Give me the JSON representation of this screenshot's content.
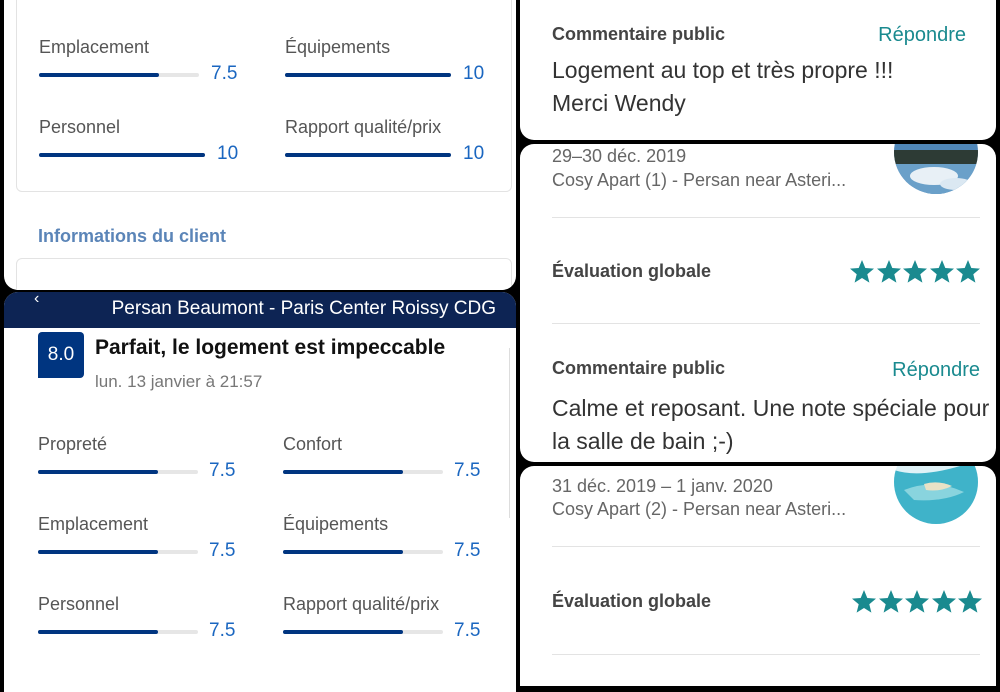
{
  "left_top": {
    "metrics": [
      {
        "label": "Emplacement",
        "value": "7.5",
        "fraction": 0.75
      },
      {
        "label": "Équipements",
        "value": "10",
        "fraction": 1.0
      },
      {
        "label": "Personnel",
        "value": "10",
        "fraction": 1.0
      },
      {
        "label": "Rapport qualité/prix",
        "value": "10",
        "fraction": 1.0
      }
    ],
    "info_title": "Informations du client"
  },
  "left_bottom": {
    "header_title": "Persan Beaumont - Paris Center Roissy CDG",
    "score": "8.0",
    "review_title": "Parfait, le logement est impeccable",
    "review_date": "lun. 13 janvier à 21:57",
    "metrics": [
      {
        "label": "Propreté",
        "value": "7.5",
        "fraction": 0.75
      },
      {
        "label": "Confort",
        "value": "7.5",
        "fraction": 0.75
      },
      {
        "label": "Emplacement",
        "value": "7.5",
        "fraction": 0.75
      },
      {
        "label": "Équipements",
        "value": "7.5",
        "fraction": 0.75
      },
      {
        "label": "Personnel",
        "value": "7.5",
        "fraction": 0.75
      },
      {
        "label": "Rapport qualité/prix",
        "value": "7.5",
        "fraction": 0.75
      }
    ]
  },
  "right_top": {
    "label": "Commentaire public",
    "reply": "Répondre",
    "comment": "Logement au top et très propre !!! Merci Wendy"
  },
  "right_mid": {
    "date": "29–30 déc. 2019",
    "listing": "Cosy Apart (1) - Persan near Asteri...",
    "overall_label": "Évaluation globale",
    "stars": 5,
    "label": "Commentaire public",
    "reply": "Répondre",
    "comment": "Calme et reposant. Une note spéciale pour la salle de bain ;-)"
  },
  "right_bottom": {
    "date": "31 déc. 2019 – 1 janv. 2020",
    "listing": "Cosy Apart (2) - Persan near Asteri...",
    "overall_label": "Évaluation globale",
    "stars": 5
  },
  "colors": {
    "bar_fill": "#003580",
    "score_bg": "#003580",
    "header_bg": "#0d2454",
    "star": "#1a8a8f",
    "reply": "#1a8a8f"
  }
}
